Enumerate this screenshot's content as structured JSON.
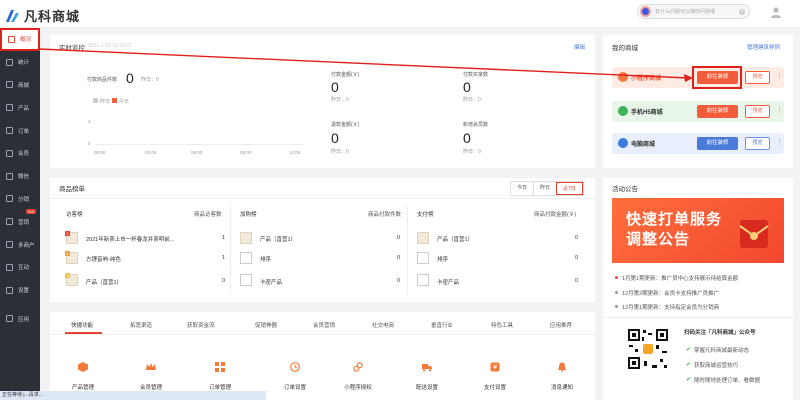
{
  "app": {
    "logo_text": "凡科商城"
  },
  "search": {
    "placeholder": "有什么问题可以随时问我哦"
  },
  "sidebar": {
    "items": [
      {
        "label": "概况",
        "icon": "overview-icon"
      },
      {
        "label": "统计",
        "icon": "stats-icon"
      },
      {
        "label": "商城",
        "icon": "store-icon"
      },
      {
        "label": "产品",
        "icon": "product-icon"
      },
      {
        "label": "订单",
        "icon": "order-icon"
      },
      {
        "label": "会员",
        "icon": "member-icon"
      },
      {
        "label": "微信",
        "icon": "wechat-icon"
      },
      {
        "label": "分销",
        "icon": "distribution-icon"
      },
      {
        "label": "营销",
        "icon": "marketing-icon",
        "badge": "hot"
      },
      {
        "label": "多商户",
        "icon": "merchant-icon"
      },
      {
        "label": "互动",
        "icon": "interact-icon"
      },
      {
        "label": "设置",
        "icon": "settings-icon"
      },
      {
        "label": "应用",
        "icon": "apps-icon"
      }
    ]
  },
  "realtime": {
    "title": "实时监控",
    "date": "2021-1-19 10:18:21",
    "edit": "编辑",
    "paid_count_label": "付款商品件数",
    "paid_count_value": "0",
    "yesterday_label": "昨日：0",
    "legend_yesterday": "昨日",
    "legend_today": "今日",
    "y_ticks": [
      "4",
      "0"
    ],
    "x_ticks": [
      "00:00",
      "03:00",
      "06:00",
      "09:00",
      "12:00"
    ],
    "stats": [
      {
        "label": "付款金额(￥)",
        "value": "0",
        "yesterday": "昨日：0"
      },
      {
        "label": "付款买家数",
        "value": "0",
        "yesterday": "昨日：0"
      },
      {
        "label": "退款金额(￥)",
        "value": "0",
        "yesterday": "昨日：0"
      },
      {
        "label": "新增会员数",
        "value": "0",
        "yesterday": "昨日：0"
      }
    ]
  },
  "rank": {
    "title": "商品榜单",
    "tabs": [
      "今日",
      "昨日",
      "近7日"
    ],
    "col1": {
      "title": "访客榜",
      "metric": "商品访客数",
      "rows": [
        {
          "name": "2021年新茶上市一杯春龙井茶明前...",
          "value": "1"
        },
        {
          "name": "方锂音响-纯色",
          "value": "1"
        },
        {
          "name": "产品（直营1）",
          "value": "0"
        }
      ]
    },
    "col2": {
      "title": "加购榜",
      "metric": "商品付款件数",
      "rows": [
        {
          "name": "产品（直营1）",
          "value": "0"
        },
        {
          "name": "排序",
          "value": "0"
        },
        {
          "name": "卡密产品",
          "value": "0"
        }
      ]
    },
    "col3": {
      "title": "支付榜",
      "metric": "商品付款金额(￥)",
      "rows": [
        {
          "name": "产品（直营1）",
          "value": "0"
        },
        {
          "name": "排序",
          "value": "0"
        },
        {
          "name": "卡密产品",
          "value": "0"
        }
      ]
    }
  },
  "functions": {
    "tabs": [
      "快捷功能",
      "拓宽渠道",
      "获取资金流",
      "促销神器",
      "会员营销",
      "社交电商",
      "垂直行业",
      "特色工具",
      "应用推荐"
    ],
    "items": [
      "产品管理",
      "会员管理",
      "订单管理",
      "订单设置",
      "小程序授权",
      "配送设置",
      "支付设置",
      "消息通知"
    ]
  },
  "myshop": {
    "title": "我的商城",
    "manage_link": "管理建筑样例",
    "shops": [
      {
        "name": "小程序商城",
        "go": "前往装修",
        "preview": "预览"
      },
      {
        "name": "手机H5商城",
        "go": "前往装修",
        "preview": "预览"
      },
      {
        "name": "电脑商城",
        "go": "前往装修",
        "preview": "预览"
      }
    ]
  },
  "notice": {
    "title": "活动公告",
    "banner_line1": "快速打单服务",
    "banner_line2": "调整公告",
    "items": [
      "1月第1期更新：推广员中心支持展示待结算金额",
      "12月第2期更新：会员卡支持推广员推广",
      "12月第1期更新：支持指定会员为分销商"
    ]
  },
  "follow": {
    "title": "扫码关注「凡科商城」公众号",
    "items": [
      "掌握凡科商城最新动态",
      "获取商城运营技巧",
      "随时随地处理订单、看数据"
    ]
  },
  "statusbar": {
    "text": "正在等待 j...请求..."
  },
  "colors": {
    "accent": "#e5432f",
    "sidebar": "#2b2f37",
    "link": "#4a7bd9"
  }
}
